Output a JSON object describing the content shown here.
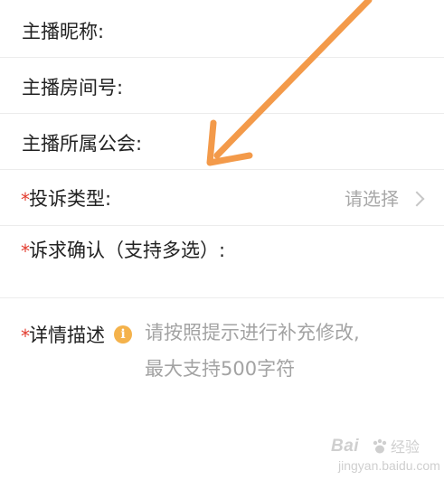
{
  "form": {
    "fields": [
      {
        "label": "主播昵称:"
      },
      {
        "label": "主播房间号:"
      },
      {
        "label": "主播所属公会:"
      }
    ],
    "complaint_type": {
      "required_mark": "*",
      "label": "投诉类型:",
      "value": "请选择"
    },
    "demand_confirm": {
      "required_mark": "*",
      "label": "诉求确认（支持多选）:"
    },
    "details": {
      "required_mark": "*",
      "label": "详情描述",
      "info_icon_glyph": "i",
      "hint_line1": "请按照提示进行补充修改,",
      "hint_line2": "最大支持500字符"
    }
  },
  "overlay": {
    "arrow_color": "#f39a4a"
  },
  "watermark": {
    "brand": "Bai",
    "suffix": "经验",
    "sub": "jingyan.baidu.com"
  },
  "colors": {
    "required": "#e23b2e",
    "placeholder": "#a8a8a8",
    "info_icon": "#f4b24b",
    "divider": "#ececec"
  }
}
